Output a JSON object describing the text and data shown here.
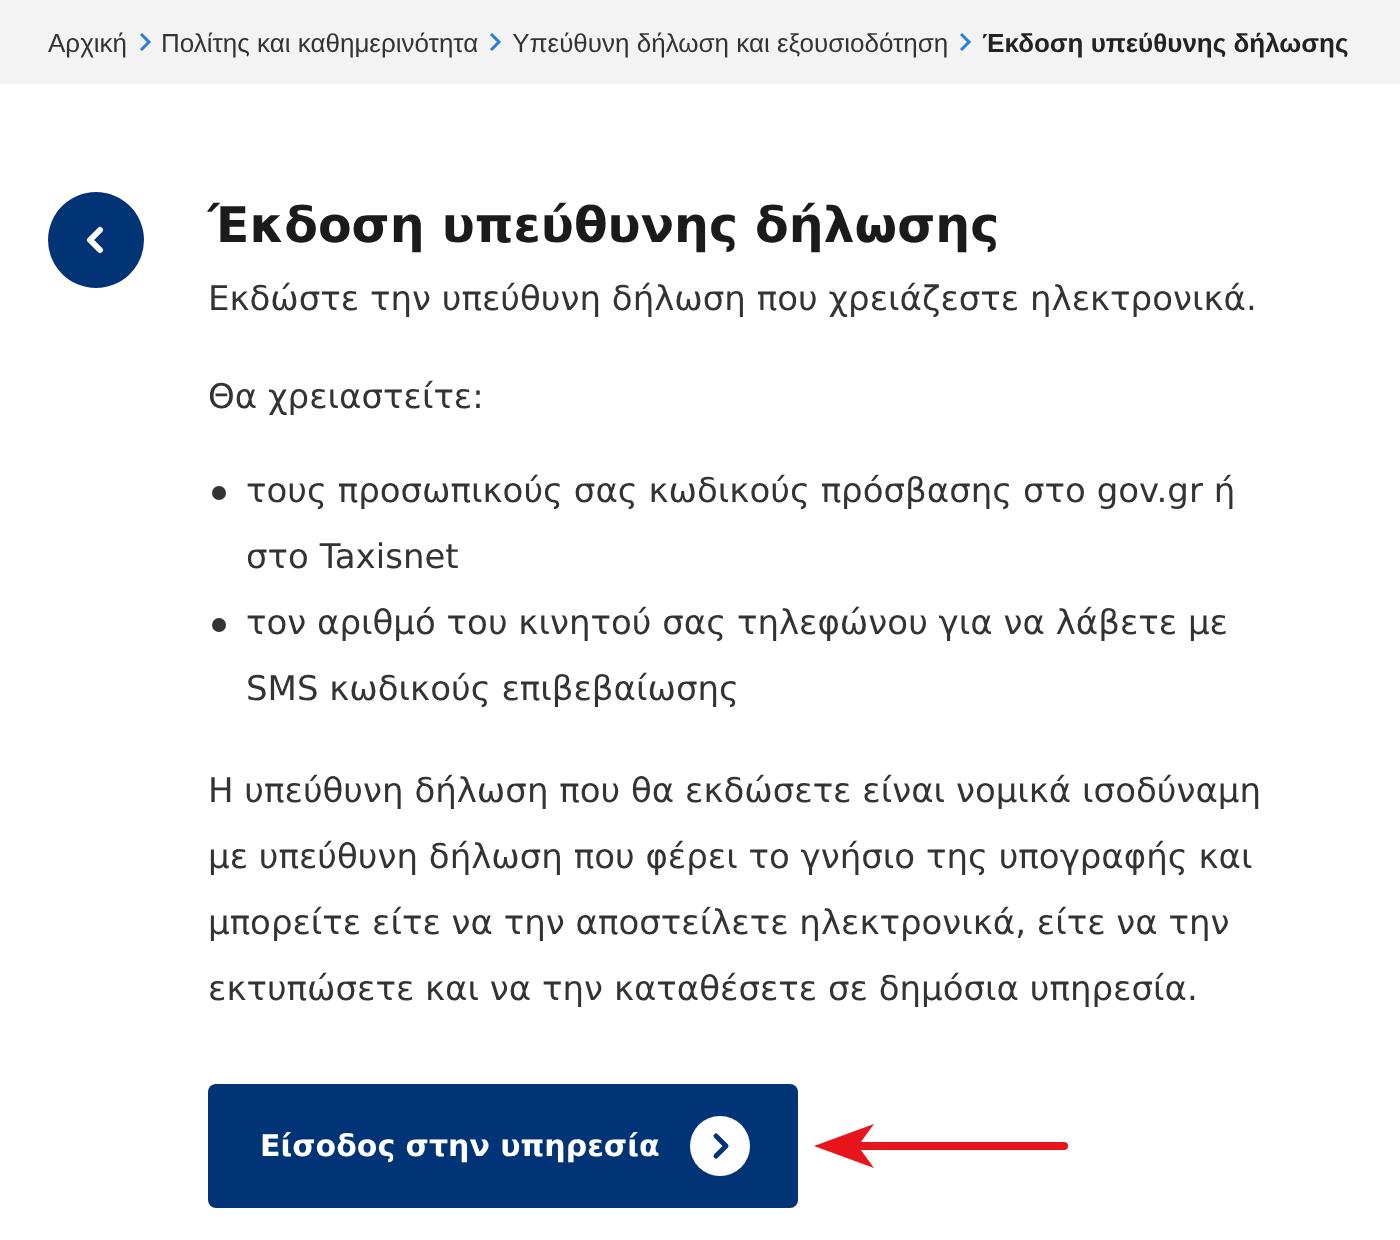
{
  "breadcrumb": [
    {
      "label": "Αρχική",
      "current": false
    },
    {
      "label": "Πολίτης και καθημερινότητα",
      "current": false
    },
    {
      "label": "Υπεύθυνη δήλωση και εξουσιοδότηση",
      "current": false
    },
    {
      "label": "Έκδοση υπεύθυνης δήλωσης",
      "current": true
    }
  ],
  "title": "Έκδοση υπεύθυνης δήλωσης",
  "lead": "Εκδώστε την υπεύθυνη δήλωση που χρειάζεστε ηλεκτρονικά.",
  "requirements_heading": "Θα χρειαστείτε:",
  "requirements": [
    "τους προσωπικούς σας κωδικούς πρόσβασης στο gov.gr ή στο Taxisnet",
    "τον αριθμό του κινητού σας τηλεφώνου για να λάβετε με SMS κωδικούς επιβεβαίωσης"
  ],
  "note": "Η υπεύθυνη δήλωση που θα εκδώσετε είναι νομικά ισοδύναμη με υπεύθυνη δήλωση που φέρει το γνήσιο της υπογραφής και μπορείτε είτε να την αποστείλετε ηλεκτρονικά, είτε να την εκτυπώσετε και να την καταθέσετε σε δημόσια υπηρεσία.",
  "start_button": {
    "label": "Είσοδος στην υπηρεσία"
  }
}
